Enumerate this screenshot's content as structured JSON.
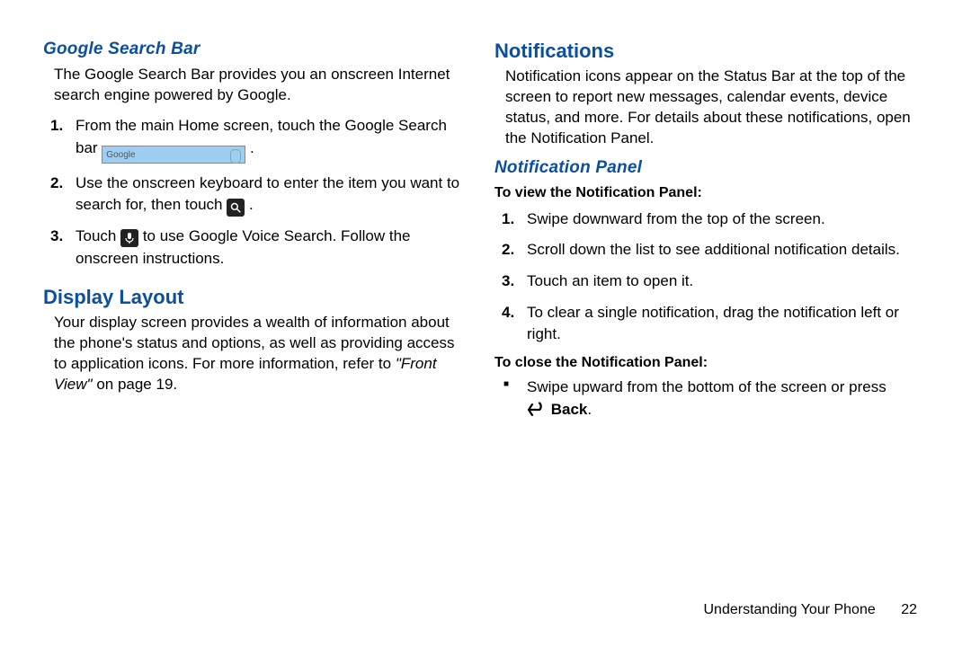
{
  "left": {
    "h1": "Google Search Bar",
    "p1": "The Google Search Bar provides you an onscreen Internet search engine powered by Google.",
    "step1a": "From the main Home screen, touch the Google Search bar ",
    "step1b": " .",
    "googleBarLabel": "Google",
    "step2a": "Use the onscreen keyboard to enter the item you want to search for, then touch ",
    "step2b": " .",
    "step3a": "Touch ",
    "step3b": " to use Google Voice Search. Follow the onscreen instructions.",
    "h2": "Display Layout",
    "p2a": "Your display screen provides a wealth of information about the phone's status and options, as well as providing access to application icons. For more information, refer to ",
    "p2ref": "\"Front View\"",
    "p2b": " on page 19."
  },
  "right": {
    "h1": "Notifications",
    "p1": "Notification icons appear on the Status Bar at the top of the screen to report new messages, calendar events, device status, and more. For details about these notifications, open the Notification Panel.",
    "h2": "Notification Panel",
    "sub1": "To view the Notification Panel:",
    "s1": "Swipe downward from the top of the screen.",
    "s2": "Scroll down the list to see additional notification details.",
    "s3": "Touch an item to open it.",
    "s4": "To clear a single notification, drag the notification left or right.",
    "sub2": "To close the Notification Panel:",
    "b1a": "Swipe upward from the bottom of the screen or press ",
    "backLabel": "Back",
    "b1b": "."
  },
  "footer": {
    "chapter": "Understanding Your Phone",
    "page": "22"
  }
}
